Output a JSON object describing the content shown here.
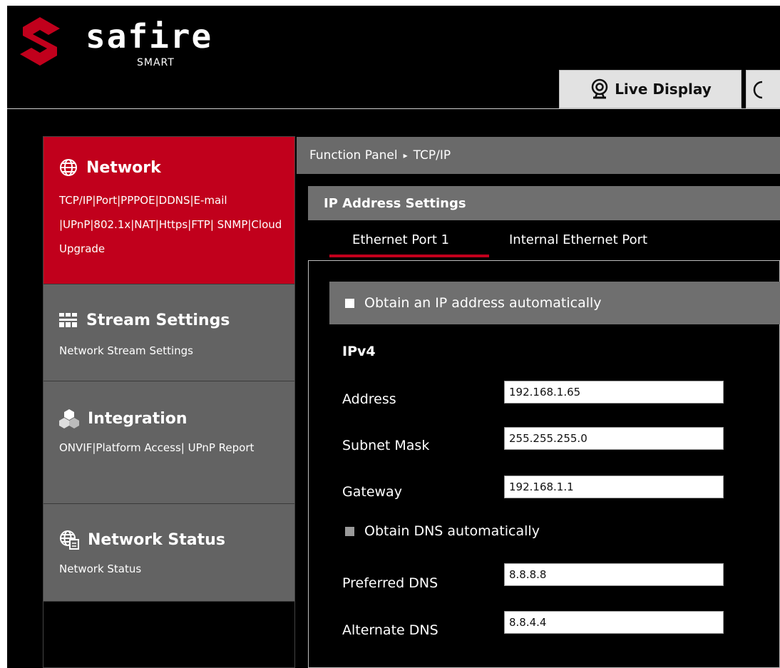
{
  "brand": {
    "name": "safire",
    "tagline": "SMART",
    "accent_color": "#c1001c"
  },
  "header_tabs": [
    {
      "label": "Live Display",
      "icon": "webcam-icon"
    }
  ],
  "sidebar": {
    "items": [
      {
        "title": "Network",
        "icon": "globe-icon",
        "desc": "TCP/IP|Port|PPPOE|DDNS|E-mail |UPnP|802.1x|NAT|Https|FTP| SNMP|Cloud Upgrade",
        "active": true
      },
      {
        "title": "Stream Settings",
        "icon": "stream-grid-icon",
        "desc": "Network Stream Settings",
        "active": false
      },
      {
        "title": "Integration",
        "icon": "cubes-icon",
        "desc": "ONVIF|Platform Access| UPnP Report",
        "active": false
      },
      {
        "title": "Network Status",
        "icon": "network-status-icon",
        "desc": "Network Status",
        "active": false
      }
    ]
  },
  "breadcrumb": {
    "root": "Function Panel",
    "separator": "▸",
    "current": "TCP/IP"
  },
  "section_title": "IP Address Settings",
  "subtabs": [
    {
      "label": "Ethernet Port 1",
      "active": true
    },
    {
      "label": "Internal Ethernet Port",
      "active": false
    }
  ],
  "form": {
    "obtain_ip_label": "Obtain an IP address automatically",
    "ipv4_label": "IPv4",
    "address_label": "Address",
    "address_value": "192.168.1.65",
    "subnet_label": "Subnet Mask",
    "subnet_value": "255.255.255.0",
    "gateway_label": "Gateway",
    "gateway_value": "192.168.1.1",
    "obtain_dns_label": "Obtain DNS automatically",
    "preferred_dns_label": "Preferred DNS",
    "preferred_dns_value": "8.8.8.8",
    "alternate_dns_label": "Alternate DNS",
    "alternate_dns_value": "8.8.4.4"
  }
}
